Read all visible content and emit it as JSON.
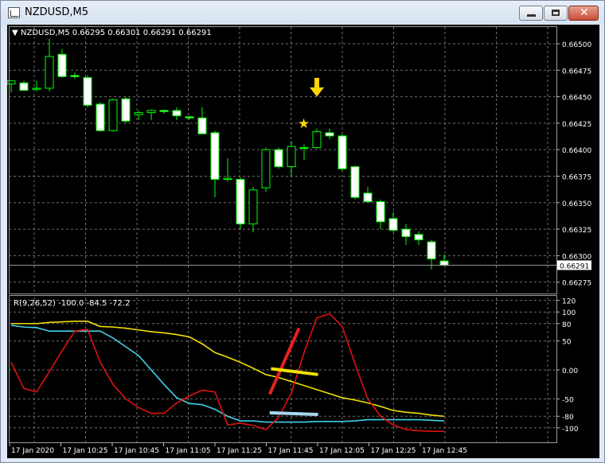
{
  "window": {
    "title": "NZDUSD,M5",
    "buttons": {
      "minimize": "minimize",
      "maximize": "maximize",
      "close": "✕"
    }
  },
  "main_pane": {
    "header": "NZDUSD,M5  0.66295 0.66301 0.66291 0.66291",
    "current_price": "0.66291"
  },
  "indicator_pane": {
    "header": "R(9,26,52) -100.0 -84.5 -72.2"
  },
  "colors": {
    "background": "#000000",
    "grid": "#6e6e6e",
    "candle_bull_fill": "#000000",
    "candle_bear_fill": "#ffffff",
    "candle_outline": "#00ff00",
    "series_fast": "#e01010",
    "series_mid": "#40d0e8",
    "series_slow": "#f0e000",
    "annotation_arrow": "#ffd700"
  },
  "chart_data": [
    {
      "type": "candlestick",
      "ylim": [
        0.66265,
        0.66515
      ],
      "yticks": [
        "0.66500",
        "0.66475",
        "0.66450",
        "0.66425",
        "0.66400",
        "0.66375",
        "0.66350",
        "0.66325",
        "0.66300",
        "0.66275"
      ],
      "candles": [
        {
          "o": 0.66462,
          "h": 0.66465,
          "l": 0.66454,
          "c": 0.66465
        },
        {
          "o": 0.66463,
          "h": 0.66465,
          "l": 0.66456,
          "c": 0.66456
        },
        {
          "o": 0.66457,
          "h": 0.66465,
          "l": 0.66455,
          "c": 0.66458
        },
        {
          "o": 0.66458,
          "h": 0.66505,
          "l": 0.66455,
          "c": 0.66488
        },
        {
          "o": 0.6649,
          "h": 0.66495,
          "l": 0.66468,
          "c": 0.66469
        },
        {
          "o": 0.6647,
          "h": 0.66473,
          "l": 0.66467,
          "c": 0.66469
        },
        {
          "o": 0.66468,
          "h": 0.6647,
          "l": 0.6644,
          "c": 0.66442
        },
        {
          "o": 0.66443,
          "h": 0.66445,
          "l": 0.66417,
          "c": 0.66418
        },
        {
          "o": 0.66418,
          "h": 0.66448,
          "l": 0.66417,
          "c": 0.66447
        },
        {
          "o": 0.66448,
          "h": 0.6645,
          "l": 0.66425,
          "c": 0.66427
        },
        {
          "o": 0.66433,
          "h": 0.66437,
          "l": 0.66428,
          "c": 0.66435
        },
        {
          "o": 0.66435,
          "h": 0.66438,
          "l": 0.66428,
          "c": 0.66437
        },
        {
          "o": 0.66437,
          "h": 0.66438,
          "l": 0.66434,
          "c": 0.66436
        },
        {
          "o": 0.66437,
          "h": 0.6644,
          "l": 0.66428,
          "c": 0.66432
        },
        {
          "o": 0.66431,
          "h": 0.66432,
          "l": 0.66428,
          "c": 0.6643
        },
        {
          "o": 0.6643,
          "h": 0.6644,
          "l": 0.66415,
          "c": 0.66415
        },
        {
          "o": 0.66416,
          "h": 0.66418,
          "l": 0.66355,
          "c": 0.66372
        },
        {
          "o": 0.66372,
          "h": 0.66392,
          "l": 0.6637,
          "c": 0.66373
        },
        {
          "o": 0.66372,
          "h": 0.66374,
          "l": 0.66325,
          "c": 0.6633
        },
        {
          "o": 0.6633,
          "h": 0.66365,
          "l": 0.66322,
          "c": 0.66362
        },
        {
          "o": 0.66364,
          "h": 0.66402,
          "l": 0.6636,
          "c": 0.664
        },
        {
          "o": 0.664,
          "h": 0.66402,
          "l": 0.66382,
          "c": 0.66384
        },
        {
          "o": 0.66384,
          "h": 0.66408,
          "l": 0.66375,
          "c": 0.66403
        },
        {
          "o": 0.66402,
          "h": 0.66405,
          "l": 0.6639,
          "c": 0.66402
        },
        {
          "o": 0.66402,
          "h": 0.6642,
          "l": 0.66401,
          "c": 0.66417
        },
        {
          "o": 0.66416,
          "h": 0.6642,
          "l": 0.6641,
          "c": 0.66413
        },
        {
          "o": 0.66413,
          "h": 0.66415,
          "l": 0.6638,
          "c": 0.66382
        },
        {
          "o": 0.66384,
          "h": 0.66385,
          "l": 0.66353,
          "c": 0.66355
        },
        {
          "o": 0.66359,
          "h": 0.66365,
          "l": 0.6635,
          "c": 0.66351
        },
        {
          "o": 0.66351,
          "h": 0.66353,
          "l": 0.66325,
          "c": 0.66332
        },
        {
          "o": 0.66335,
          "h": 0.66341,
          "l": 0.66322,
          "c": 0.66324
        },
        {
          "o": 0.66325,
          "h": 0.6633,
          "l": 0.6631,
          "c": 0.66318
        },
        {
          "o": 0.6632,
          "h": 0.66323,
          "l": 0.6631,
          "c": 0.66315
        },
        {
          "o": 0.66313,
          "h": 0.66315,
          "l": 0.66287,
          "c": 0.66297
        },
        {
          "o": 0.66295,
          "h": 0.66301,
          "l": 0.66291,
          "c": 0.66291
        }
      ]
    },
    {
      "type": "line",
      "ylim": [
        -125,
        125
      ],
      "yticks": [
        120,
        100,
        80,
        50,
        0,
        -50,
        -80,
        -100
      ],
      "ytick_labels": [
        "120",
        "100",
        "80",
        "50",
        "0.00",
        "-50",
        "-80",
        "-100"
      ],
      "x_labels": [
        "17 Jan 2020",
        "17 Jan 10:25",
        "17 Jan 10:45",
        "17 Jan 11:05",
        "17 Jan 11:25",
        "17 Jan 11:45",
        "17 Jan 12:05",
        "17 Jan 12:25",
        "17 Jan 12:45"
      ],
      "series": [
        {
          "values": [
            13,
            -32,
            -38,
            -3,
            33,
            67,
            70,
            13,
            -25,
            -50,
            -65,
            -75,
            -75,
            -57,
            -45,
            -35,
            -38,
            -95,
            -92,
            -96,
            -103,
            -82,
            -40,
            30,
            90,
            97,
            75,
            10,
            -50,
            -80,
            -95,
            -103,
            -105,
            -106,
            -106
          ]
        },
        {
          "values": [
            77,
            74,
            73,
            67,
            67,
            67,
            67,
            67,
            55,
            40,
            25,
            0,
            -25,
            -48,
            -58,
            -60,
            -68,
            -80,
            -88,
            -88,
            -90,
            -90,
            -90,
            -90,
            -89,
            -89,
            -89,
            -88,
            -86,
            -86,
            -86,
            -86,
            -86,
            -87,
            -88
          ]
        },
        {
          "values": [
            80,
            80,
            80,
            82,
            83,
            84,
            84,
            75,
            74,
            72,
            69,
            66,
            64,
            61,
            57,
            45,
            30,
            22,
            13,
            3,
            -8,
            -13,
            -20,
            -27,
            -34,
            -41,
            -48,
            -52,
            -57,
            -63,
            -70,
            -73,
            -75,
            -78,
            -80
          ]
        }
      ]
    }
  ]
}
